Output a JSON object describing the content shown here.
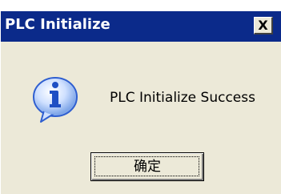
{
  "window": {
    "title": "PLC Initialize",
    "close_glyph": "X"
  },
  "dialog": {
    "icon": "info-icon",
    "message": "PLC Initialize Success",
    "ok_label": "确定"
  },
  "colors": {
    "titlebar": "#0b2a8a",
    "face": "#ece9d8",
    "icon_bubble": "#2f5fd0"
  }
}
